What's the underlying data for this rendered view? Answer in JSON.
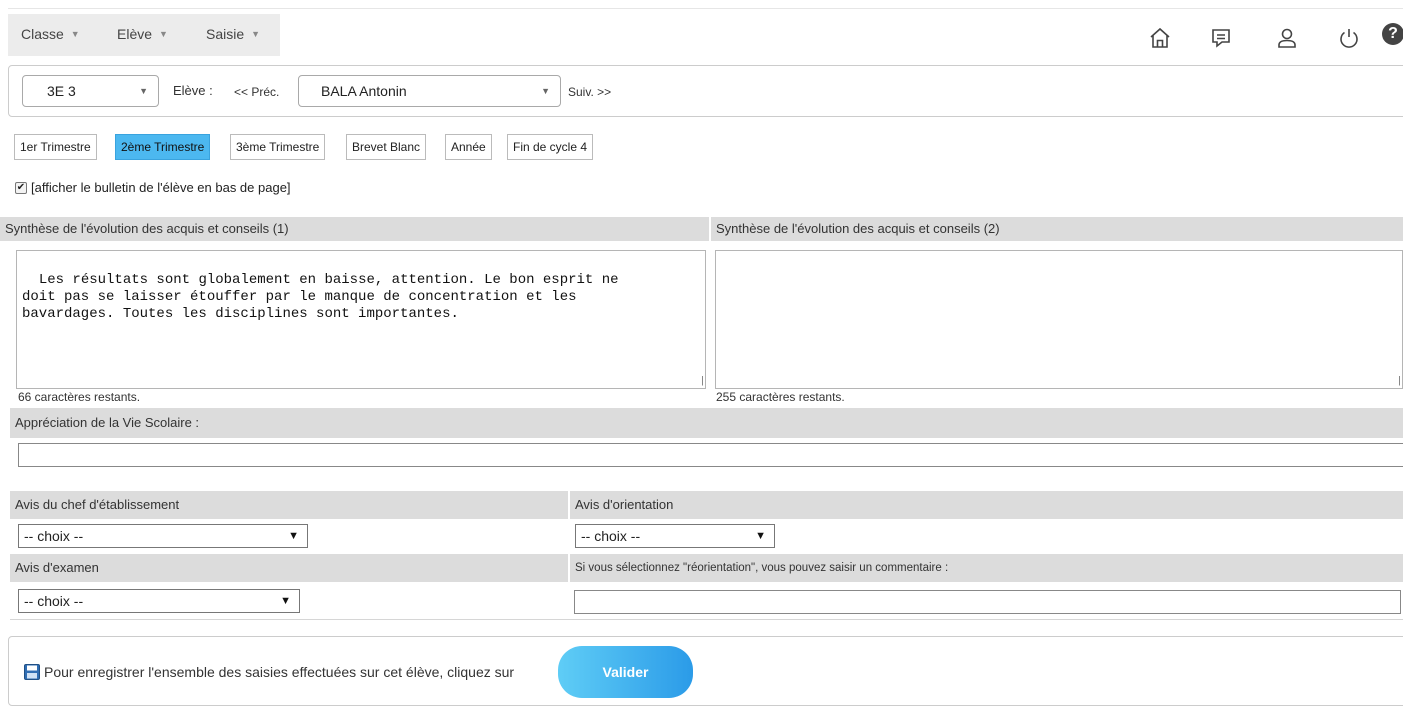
{
  "menu": {
    "classe": "Classe",
    "eleve": "Elève",
    "saisie": "Saisie"
  },
  "icons": [
    "home-icon",
    "message-icon",
    "user-icon",
    "power-icon",
    "help-icon"
  ],
  "selector": {
    "classe_value": "3E 3",
    "eleve_label": "Elève :",
    "prev_label": "<< Préc.",
    "eleve_value": "BALA Antonin",
    "next_label": "Suiv. >>"
  },
  "tabs": [
    {
      "label": "1er Trimestre",
      "active": false
    },
    {
      "label": "2ème Trimestre",
      "active": true
    },
    {
      "label": "3ème Trimestre",
      "active": false
    },
    {
      "label": "Brevet Blanc",
      "active": false
    },
    {
      "label": "Année",
      "active": false
    },
    {
      "label": "Fin de cycle 4",
      "active": false
    }
  ],
  "show_bulletin": {
    "checked": true,
    "label": "[afficher le bulletin de l'élève en bas de page]"
  },
  "synthese1": {
    "title": "Synthèse de l'évolution des acquis et conseils (1)",
    "text": "Les résultats sont globalement en baisse, attention. Le bon esprit ne\ndoit pas se laisser étouffer par le manque de concentration et les\nbavardages. Toutes les disciplines sont importantes.",
    "remaining": "66 caractères restants."
  },
  "synthese2": {
    "title": "Synthèse de l'évolution des acquis et conseils (2)",
    "text": "",
    "remaining": "255 caractères restants."
  },
  "vie_scolaire": {
    "title": "Appréciation de la Vie Scolaire :",
    "value": ""
  },
  "avis_chef": {
    "title": "Avis du chef d'établissement",
    "value": "-- choix --"
  },
  "avis_orientation": {
    "title": "Avis d'orientation",
    "value": "-- choix --"
  },
  "avis_examen": {
    "title": "Avis d'examen",
    "value": "-- choix --"
  },
  "reorientation": {
    "hint": "Si vous sélectionnez \"réorientation\", vous pouvez saisir un commentaire :",
    "value": ""
  },
  "footer": {
    "text": "Pour enregistrer l'ensemble des saisies effectuées sur cet élève, cliquez sur",
    "button": "Valider"
  },
  "colors": {
    "active_tab": "#4cb8f0",
    "header_grey": "#dcdcdc",
    "button_start": "#5fcdf6",
    "button_end": "#2b9be8"
  }
}
